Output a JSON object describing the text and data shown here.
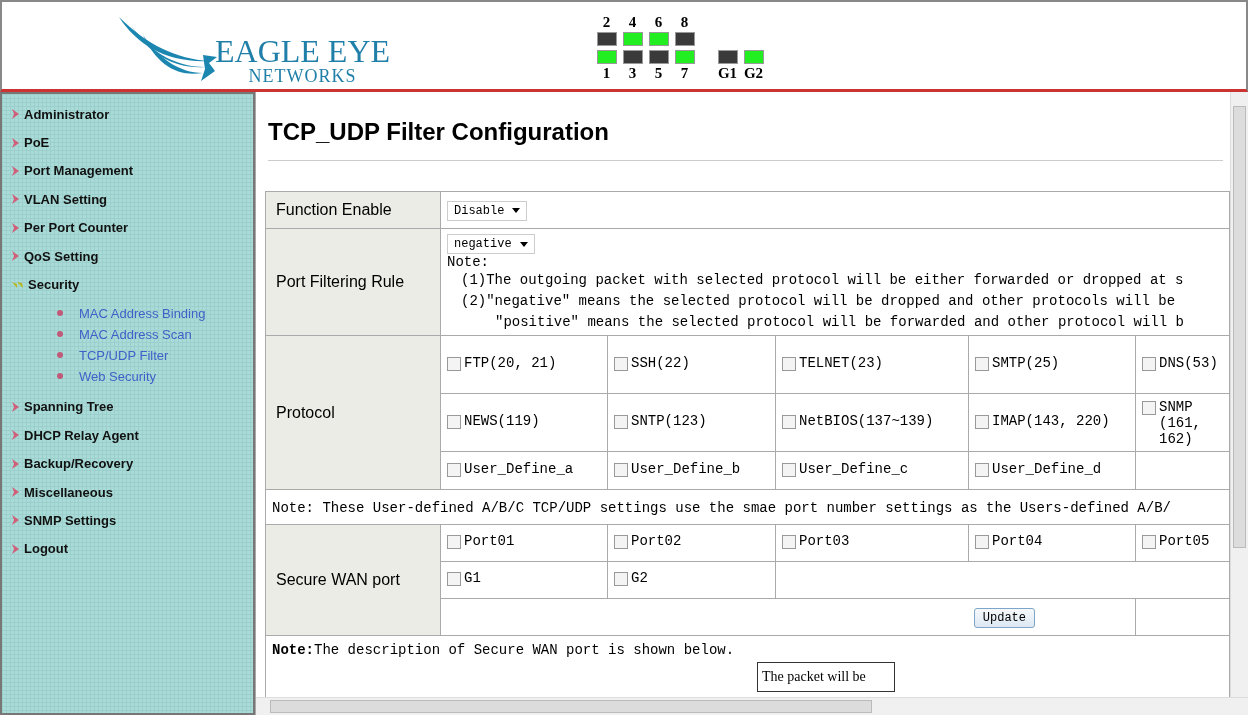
{
  "header": {
    "brand": "EAGLE EYE",
    "brand_sub": "NETWORKS",
    "ports_top": [
      {
        "label": "2",
        "on": false
      },
      {
        "label": "4",
        "on": true
      },
      {
        "label": "6",
        "on": true
      },
      {
        "label": "8",
        "on": false
      }
    ],
    "ports_bottom": [
      {
        "label": "1",
        "on": true
      },
      {
        "label": "3",
        "on": false
      },
      {
        "label": "5",
        "on": false
      },
      {
        "label": "7",
        "on": true
      }
    ],
    "uplinks": [
      {
        "label": "G1",
        "on": false
      },
      {
        "label": "G2",
        "on": true
      }
    ]
  },
  "sidebar": {
    "items": [
      {
        "label": "Administrator",
        "expanded": false
      },
      {
        "label": "PoE",
        "expanded": false
      },
      {
        "label": "Port Management",
        "expanded": false
      },
      {
        "label": "VLAN Setting",
        "expanded": false
      },
      {
        "label": "Per Port Counter",
        "expanded": false
      },
      {
        "label": "QoS Setting",
        "expanded": false
      },
      {
        "label": "Security",
        "expanded": true,
        "children": [
          {
            "label": "MAC Address Binding"
          },
          {
            "label": "MAC Address Scan"
          },
          {
            "label": "TCP/UDP Filter"
          },
          {
            "label": "Web Security"
          }
        ]
      },
      {
        "label": "Spanning Tree",
        "expanded": false
      },
      {
        "label": "DHCP Relay Agent",
        "expanded": false
      },
      {
        "label": "Backup/Recovery",
        "expanded": false
      },
      {
        "label": "Miscellaneous",
        "expanded": false
      },
      {
        "label": "SNMP Settings",
        "expanded": false
      },
      {
        "label": "Logout",
        "expanded": false
      }
    ]
  },
  "page": {
    "title": "TCP_UDP Filter Configuration"
  },
  "form": {
    "function_enable": {
      "label": "Function Enable",
      "value": "Disable"
    },
    "filtering_rule": {
      "label": "Port Filtering Rule",
      "value": "negative",
      "note_title": "Note:",
      "notes": [
        "(1)The outgoing packet with selected protocol will be either forwarded or dropped at s",
        "(2)″negative″ means the selected protocol will be dropped and other protocols will be",
        "″positive″ means the selected protocol will be forwarded and other protocol will b"
      ]
    },
    "protocol": {
      "label": "Protocol",
      "rows": [
        [
          {
            "label": "FTP(20, 21)",
            "checked": false
          },
          {
            "label": "SSH(22)",
            "checked": false
          },
          {
            "label": "TELNET(23)",
            "checked": false
          },
          {
            "label": "SMTP(25)",
            "checked": false
          },
          {
            "label": "DNS(53)",
            "checked": false
          }
        ],
        [
          {
            "label": "NEWS(119)",
            "checked": false
          },
          {
            "label": "SNTP(123)",
            "checked": false
          },
          {
            "label": "NetBIOS(137~139)",
            "checked": false
          },
          {
            "label": "IMAP(143, 220)",
            "checked": false
          },
          {
            "label": "SNMP (161, 162)",
            "checked": false
          }
        ],
        [
          {
            "label": "User_Define_a",
            "checked": false
          },
          {
            "label": "User_Define_b",
            "checked": false
          },
          {
            "label": "User_Define_c",
            "checked": false
          },
          {
            "label": "User_Define_d",
            "checked": false
          }
        ]
      ]
    },
    "protocol_note": "Note: These User-defined A/B/C TCP/UDP settings use the smae port number settings as the Users-defined A/B/",
    "wan": {
      "label": "Secure WAN port",
      "rows": [
        [
          {
            "label": "Port01",
            "checked": false
          },
          {
            "label": "Port02",
            "checked": false
          },
          {
            "label": "Port03",
            "checked": false
          },
          {
            "label": "Port04",
            "checked": false
          },
          {
            "label": "Port05",
            "checked": false
          }
        ],
        [
          {
            "label": "G1",
            "checked": false
          },
          {
            "label": "G2",
            "checked": false
          }
        ]
      ],
      "button": "Update"
    },
    "wan_note": "**Note:**The description of Secure WAN port is shown below.",
    "diagram_box": "The packet will be"
  }
}
